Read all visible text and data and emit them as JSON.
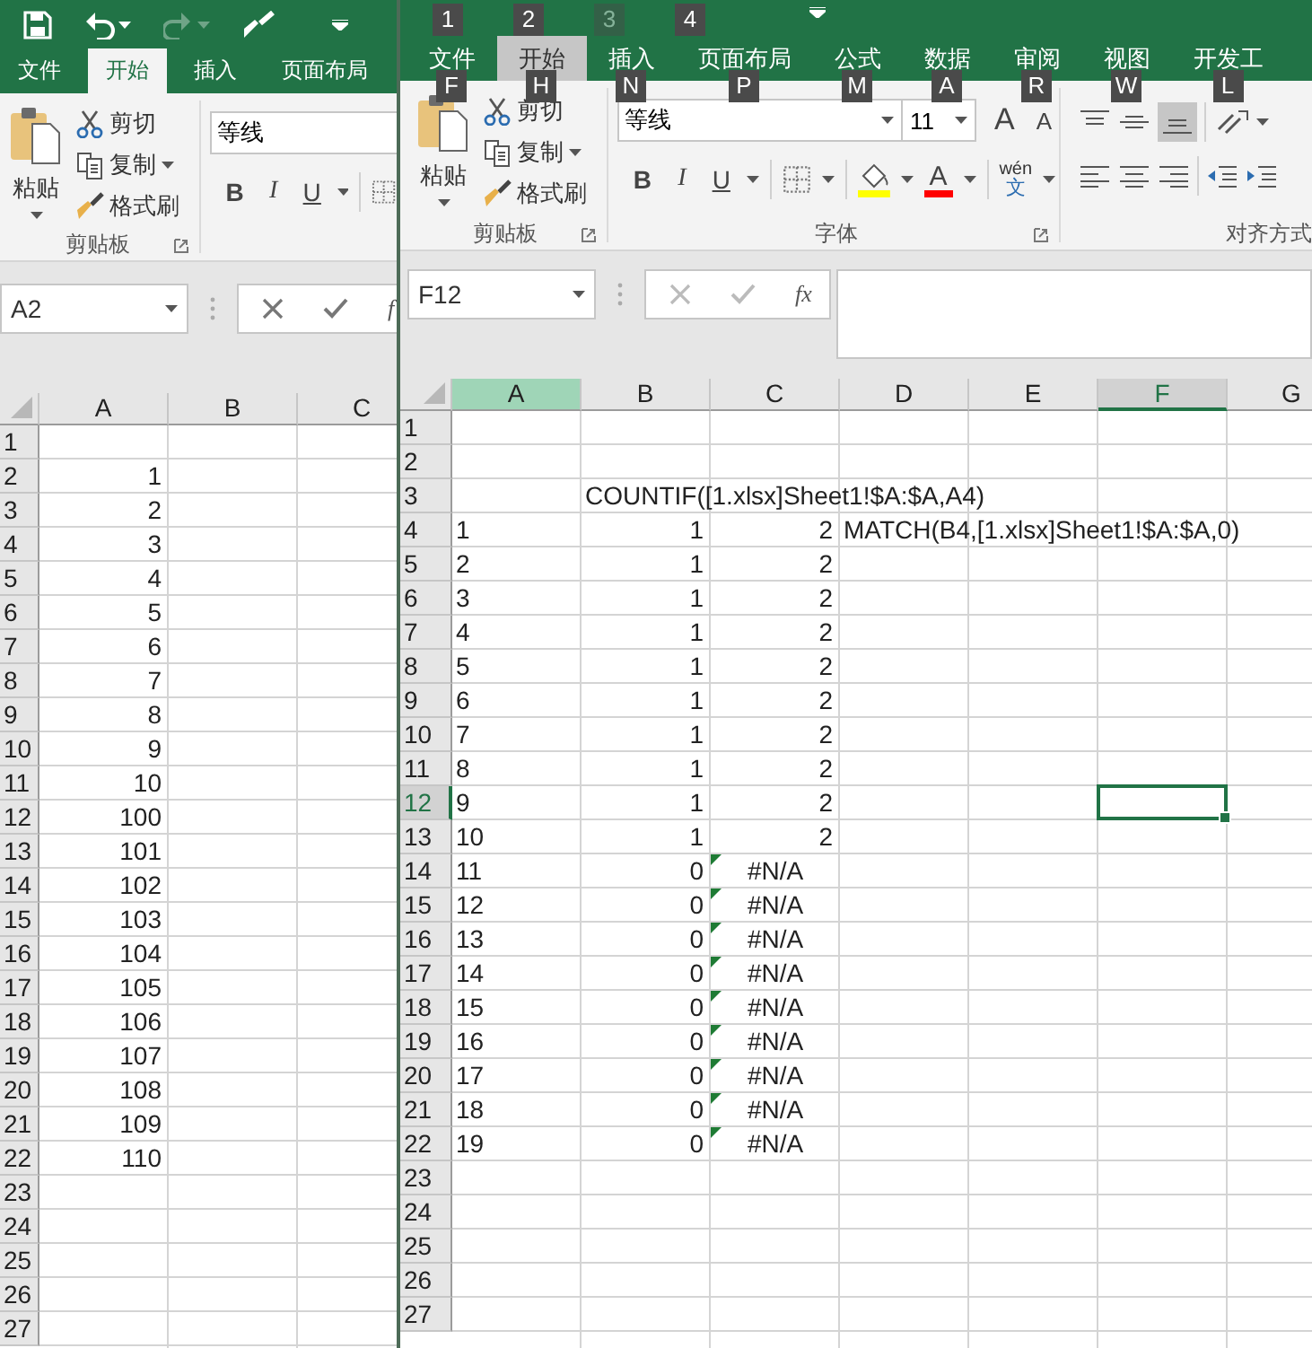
{
  "left_window": {
    "quick_access": [
      {
        "kind": "save",
        "disabled": false
      },
      {
        "kind": "undo",
        "disabled": false
      },
      {
        "kind": "redo",
        "disabled": true
      },
      {
        "kind": "brush",
        "disabled": false
      }
    ],
    "tabs": [
      {
        "label": "文件",
        "selected": false
      },
      {
        "label": "开始",
        "selected": true
      },
      {
        "label": "插入",
        "selected": false
      },
      {
        "label": "页面布局",
        "selected": false
      }
    ],
    "clipboard": {
      "paste": "粘贴",
      "cut": "剪切",
      "copy": "复制",
      "format_painter": "格式刷",
      "group_label": "剪贴板"
    },
    "font": {
      "name": "等线",
      "buttons": [
        {
          "label": "B",
          "kind": "bold"
        },
        {
          "label": "I",
          "kind": "italic"
        },
        {
          "label": "U",
          "kind": "underline"
        }
      ]
    },
    "name_box": "A2",
    "insert_function": "f",
    "columns": [
      {
        "label": "A",
        "selected": false,
        "hovered": false
      },
      {
        "label": "B",
        "selected": false,
        "hovered": false
      },
      {
        "label": "C",
        "selected": false,
        "hovered": false
      }
    ],
    "rows": [
      {
        "header": "1",
        "selected": false,
        "cells": [
          null,
          null,
          null
        ]
      },
      {
        "header": "2",
        "selected": false,
        "cells": [
          {
            "text": "1",
            "kind": "number"
          },
          null,
          null
        ]
      },
      {
        "header": "3",
        "selected": false,
        "cells": [
          {
            "text": "2",
            "kind": "number"
          },
          null,
          null
        ]
      },
      {
        "header": "4",
        "selected": false,
        "cells": [
          {
            "text": "3",
            "kind": "number"
          },
          null,
          null
        ]
      },
      {
        "header": "5",
        "selected": false,
        "cells": [
          {
            "text": "4",
            "kind": "number"
          },
          null,
          null
        ]
      },
      {
        "header": "6",
        "selected": false,
        "cells": [
          {
            "text": "5",
            "kind": "number"
          },
          null,
          null
        ]
      },
      {
        "header": "7",
        "selected": false,
        "cells": [
          {
            "text": "6",
            "kind": "number"
          },
          null,
          null
        ]
      },
      {
        "header": "8",
        "selected": false,
        "cells": [
          {
            "text": "7",
            "kind": "number"
          },
          null,
          null
        ]
      },
      {
        "header": "9",
        "selected": false,
        "cells": [
          {
            "text": "8",
            "kind": "number"
          },
          null,
          null
        ]
      },
      {
        "header": "10",
        "selected": false,
        "cells": [
          {
            "text": "9",
            "kind": "number"
          },
          null,
          null
        ]
      },
      {
        "header": "11",
        "selected": false,
        "cells": [
          {
            "text": "10",
            "kind": "number"
          },
          null,
          null
        ]
      },
      {
        "header": "12",
        "selected": false,
        "cells": [
          {
            "text": "100",
            "kind": "number"
          },
          null,
          null
        ]
      },
      {
        "header": "13",
        "selected": false,
        "cells": [
          {
            "text": "101",
            "kind": "number"
          },
          null,
          null
        ]
      },
      {
        "header": "14",
        "selected": false,
        "cells": [
          {
            "text": "102",
            "kind": "number"
          },
          null,
          null
        ]
      },
      {
        "header": "15",
        "selected": false,
        "cells": [
          {
            "text": "103",
            "kind": "number"
          },
          null,
          null
        ]
      },
      {
        "header": "16",
        "selected": false,
        "cells": [
          {
            "text": "104",
            "kind": "number"
          },
          null,
          null
        ]
      },
      {
        "header": "17",
        "selected": false,
        "cells": [
          {
            "text": "105",
            "kind": "number"
          },
          null,
          null
        ]
      },
      {
        "header": "18",
        "selected": false,
        "cells": [
          {
            "text": "106",
            "kind": "number"
          },
          null,
          null
        ]
      },
      {
        "header": "19",
        "selected": false,
        "cells": [
          {
            "text": "107",
            "kind": "number"
          },
          null,
          null
        ]
      },
      {
        "header": "20",
        "selected": false,
        "cells": [
          {
            "text": "108",
            "kind": "number"
          },
          null,
          null
        ]
      },
      {
        "header": "21",
        "selected": false,
        "cells": [
          {
            "text": "109",
            "kind": "number"
          },
          null,
          null
        ]
      },
      {
        "header": "22",
        "selected": false,
        "cells": [
          {
            "text": "110",
            "kind": "number"
          },
          null,
          null
        ]
      },
      {
        "header": "23",
        "selected": false,
        "cells": [
          null,
          null,
          null
        ]
      },
      {
        "header": "24",
        "selected": false,
        "cells": [
          null,
          null,
          null
        ]
      },
      {
        "header": "25",
        "selected": false,
        "cells": [
          null,
          null,
          null
        ]
      },
      {
        "header": "26",
        "selected": false,
        "cells": [
          null,
          null,
          null
        ]
      },
      {
        "header": "27",
        "selected": false,
        "cells": [
          null,
          null,
          null
        ]
      }
    ]
  },
  "right_window": {
    "quick_access_keytips": [
      {
        "label": "1",
        "disabled": false
      },
      {
        "label": "2",
        "disabled": false
      },
      {
        "label": "3",
        "disabled": true
      },
      {
        "label": "4",
        "disabled": false
      }
    ],
    "tabs": [
      {
        "label": "文件",
        "selected": false,
        "keytip": "F"
      },
      {
        "label": "开始",
        "selected": true,
        "keytip": "H"
      },
      {
        "label": "插入",
        "selected": false,
        "keytip": "N"
      },
      {
        "label": "页面布局",
        "selected": false,
        "keytip": "P"
      },
      {
        "label": "公式",
        "selected": false,
        "keytip": "M"
      },
      {
        "label": "数据",
        "selected": false,
        "keytip": "A"
      },
      {
        "label": "审阅",
        "selected": false,
        "keytip": "R"
      },
      {
        "label": "视图",
        "selected": false,
        "keytip": "W"
      },
      {
        "label": "开发工",
        "selected": false,
        "keytip": "L"
      }
    ],
    "clipboard": {
      "paste": "粘贴",
      "cut": "剪切",
      "copy": "复制",
      "format_painter": "格式刷",
      "group_label": "剪贴板"
    },
    "font": {
      "name": "等线",
      "size": "11",
      "grow": "A",
      "shrink": "A",
      "buttons": [
        {
          "label": "B",
          "kind": "bold"
        },
        {
          "label": "I",
          "kind": "italic"
        },
        {
          "label": "U",
          "kind": "underline"
        }
      ],
      "font_color": "A",
      "phonetic": "wén",
      "phonetic_base": "文",
      "group_label": "字体"
    },
    "alignment": {
      "group_label": "对齐方式"
    },
    "name_box": "F12",
    "insert_function": "fx",
    "columns": [
      {
        "label": "A",
        "selected": false,
        "hovered": true
      },
      {
        "label": "B",
        "selected": false,
        "hovered": false
      },
      {
        "label": "C",
        "selected": false,
        "hovered": false
      },
      {
        "label": "D",
        "selected": false,
        "hovered": false
      },
      {
        "label": "E",
        "selected": false,
        "hovered": false
      },
      {
        "label": "F",
        "selected": true,
        "hovered": false
      },
      {
        "label": "G",
        "selected": false,
        "hovered": false
      }
    ],
    "rows": [
      {
        "header": "1",
        "selected": false,
        "cells": [
          null,
          null,
          null,
          null,
          null,
          null,
          null
        ]
      },
      {
        "header": "2",
        "selected": false,
        "cells": [
          null,
          null,
          null,
          null,
          null,
          null,
          null
        ]
      },
      {
        "header": "3",
        "selected": false,
        "cells": [
          null,
          {
            "text": "COUNTIF([1.xlsx]Sheet1!$A:$A,A4)",
            "kind": "text"
          },
          null,
          null,
          null,
          null,
          null
        ]
      },
      {
        "header": "4",
        "selected": false,
        "cells": [
          {
            "text": "1",
            "kind": "text"
          },
          {
            "text": "1",
            "kind": "number"
          },
          {
            "text": "2",
            "kind": "number"
          },
          {
            "text": "MATCH(B4,[1.xlsx]Sheet1!$A:$A,0)",
            "kind": "text"
          },
          null,
          null,
          null
        ]
      },
      {
        "header": "5",
        "selected": false,
        "cells": [
          {
            "text": "2",
            "kind": "text"
          },
          {
            "text": "1",
            "kind": "number"
          },
          {
            "text": "2",
            "kind": "number"
          },
          null,
          null,
          null,
          null
        ]
      },
      {
        "header": "6",
        "selected": false,
        "cells": [
          {
            "text": "3",
            "kind": "text"
          },
          {
            "text": "1",
            "kind": "number"
          },
          {
            "text": "2",
            "kind": "number"
          },
          null,
          null,
          null,
          null
        ]
      },
      {
        "header": "7",
        "selected": false,
        "cells": [
          {
            "text": "4",
            "kind": "text"
          },
          {
            "text": "1",
            "kind": "number"
          },
          {
            "text": "2",
            "kind": "number"
          },
          null,
          null,
          null,
          null
        ]
      },
      {
        "header": "8",
        "selected": false,
        "cells": [
          {
            "text": "5",
            "kind": "text"
          },
          {
            "text": "1",
            "kind": "number"
          },
          {
            "text": "2",
            "kind": "number"
          },
          null,
          null,
          null,
          null
        ]
      },
      {
        "header": "9",
        "selected": false,
        "cells": [
          {
            "text": "6",
            "kind": "text"
          },
          {
            "text": "1",
            "kind": "number"
          },
          {
            "text": "2",
            "kind": "number"
          },
          null,
          null,
          null,
          null
        ]
      },
      {
        "header": "10",
        "selected": false,
        "cells": [
          {
            "text": "7",
            "kind": "text"
          },
          {
            "text": "1",
            "kind": "number"
          },
          {
            "text": "2",
            "kind": "number"
          },
          null,
          null,
          null,
          null
        ]
      },
      {
        "header": "11",
        "selected": false,
        "cells": [
          {
            "text": "8",
            "kind": "text"
          },
          {
            "text": "1",
            "kind": "number"
          },
          {
            "text": "2",
            "kind": "number"
          },
          null,
          null,
          null,
          null
        ]
      },
      {
        "header": "12",
        "selected": true,
        "cells": [
          {
            "text": "9",
            "kind": "text"
          },
          {
            "text": "1",
            "kind": "number"
          },
          {
            "text": "2",
            "kind": "number"
          },
          null,
          null,
          null,
          null
        ]
      },
      {
        "header": "13",
        "selected": false,
        "cells": [
          {
            "text": "10",
            "kind": "text"
          },
          {
            "text": "1",
            "kind": "number"
          },
          {
            "text": "2",
            "kind": "number"
          },
          null,
          null,
          null,
          null
        ]
      },
      {
        "header": "14",
        "selected": false,
        "cells": [
          {
            "text": "11",
            "kind": "text"
          },
          {
            "text": "0",
            "kind": "number"
          },
          {
            "text": "#N/A",
            "kind": "error"
          },
          null,
          null,
          null,
          null
        ]
      },
      {
        "header": "15",
        "selected": false,
        "cells": [
          {
            "text": "12",
            "kind": "text"
          },
          {
            "text": "0",
            "kind": "number"
          },
          {
            "text": "#N/A",
            "kind": "error"
          },
          null,
          null,
          null,
          null
        ]
      },
      {
        "header": "16",
        "selected": false,
        "cells": [
          {
            "text": "13",
            "kind": "text"
          },
          {
            "text": "0",
            "kind": "number"
          },
          {
            "text": "#N/A",
            "kind": "error"
          },
          null,
          null,
          null,
          null
        ]
      },
      {
        "header": "17",
        "selected": false,
        "cells": [
          {
            "text": "14",
            "kind": "text"
          },
          {
            "text": "0",
            "kind": "number"
          },
          {
            "text": "#N/A",
            "kind": "error"
          },
          null,
          null,
          null,
          null
        ]
      },
      {
        "header": "18",
        "selected": false,
        "cells": [
          {
            "text": "15",
            "kind": "text"
          },
          {
            "text": "0",
            "kind": "number"
          },
          {
            "text": "#N/A",
            "kind": "error"
          },
          null,
          null,
          null,
          null
        ]
      },
      {
        "header": "19",
        "selected": false,
        "cells": [
          {
            "text": "16",
            "kind": "text"
          },
          {
            "text": "0",
            "kind": "number"
          },
          {
            "text": "#N/A",
            "kind": "error"
          },
          null,
          null,
          null,
          null
        ]
      },
      {
        "header": "20",
        "selected": false,
        "cells": [
          {
            "text": "17",
            "kind": "text"
          },
          {
            "text": "0",
            "kind": "number"
          },
          {
            "text": "#N/A",
            "kind": "error"
          },
          null,
          null,
          null,
          null
        ]
      },
      {
        "header": "21",
        "selected": false,
        "cells": [
          {
            "text": "18",
            "kind": "text"
          },
          {
            "text": "0",
            "kind": "number"
          },
          {
            "text": "#N/A",
            "kind": "error"
          },
          null,
          null,
          null,
          null
        ]
      },
      {
        "header": "22",
        "selected": false,
        "cells": [
          {
            "text": "19",
            "kind": "text"
          },
          {
            "text": "0",
            "kind": "number"
          },
          {
            "text": "#N/A",
            "kind": "error"
          },
          null,
          null,
          null,
          null
        ]
      },
      {
        "header": "23",
        "selected": false,
        "cells": [
          null,
          null,
          null,
          null,
          null,
          null,
          null
        ]
      },
      {
        "header": "24",
        "selected": false,
        "cells": [
          null,
          null,
          null,
          null,
          null,
          null,
          null
        ]
      },
      {
        "header": "25",
        "selected": false,
        "cells": [
          null,
          null,
          null,
          null,
          null,
          null,
          null
        ]
      },
      {
        "header": "26",
        "selected": false,
        "cells": [
          null,
          null,
          null,
          null,
          null,
          null,
          null
        ]
      },
      {
        "header": "27",
        "selected": false,
        "cells": [
          null,
          null,
          null,
          null,
          null,
          null,
          null
        ]
      }
    ]
  }
}
